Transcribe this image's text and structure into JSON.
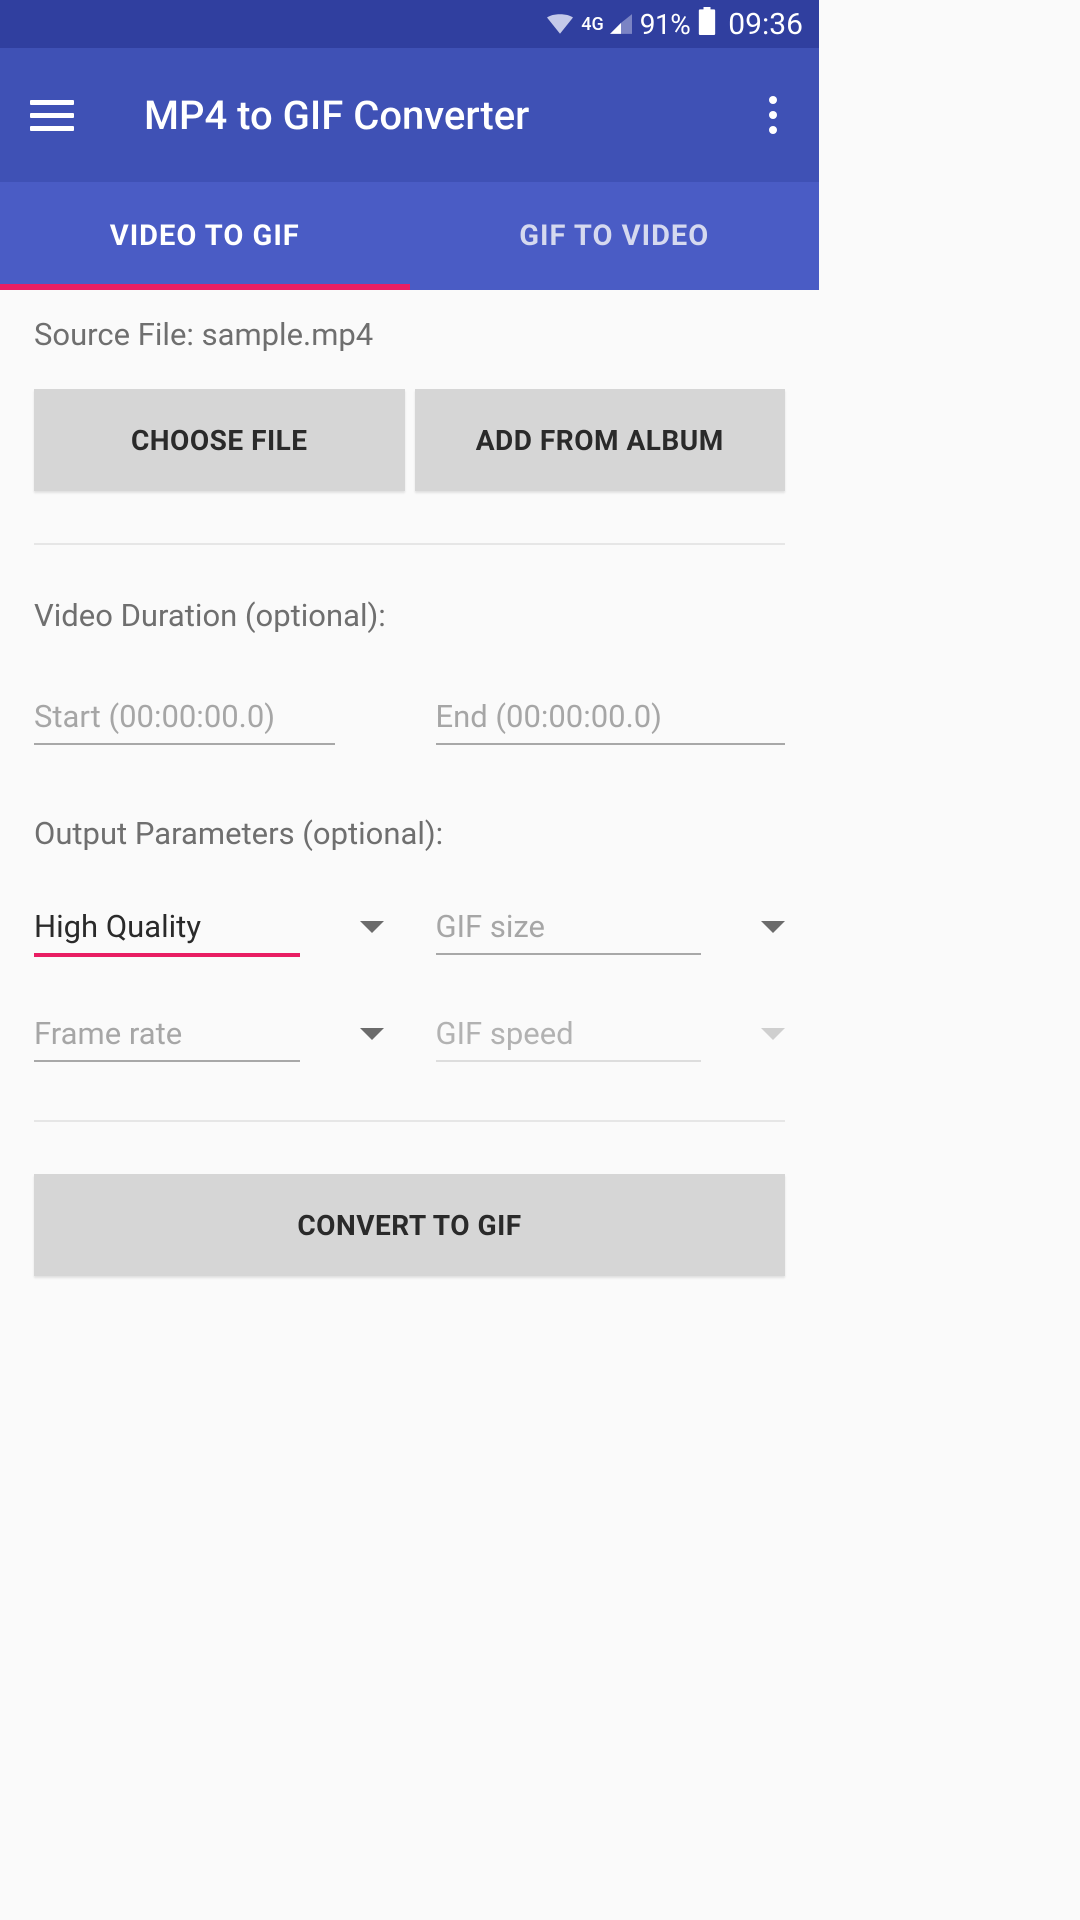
{
  "status": {
    "network": "4G",
    "battery": "91%",
    "time": "09:36"
  },
  "header": {
    "title": "MP4 to GIF Converter"
  },
  "tabs": {
    "tab1": "VIDEO TO GIF",
    "tab2": "GIF TO VIDEO"
  },
  "source": {
    "label": "Source File: ",
    "filename": "sample.mp4"
  },
  "buttons": {
    "choose_file": "CHOOSE FILE",
    "add_from_album": "ADD FROM ALBUM",
    "convert": "CONVERT TO GIF"
  },
  "duration": {
    "label": "Video Duration (optional):",
    "start_placeholder": "Start (00:00:00.0)",
    "end_placeholder": "End (00:00:00.0)"
  },
  "output": {
    "label": "Output Parameters (optional):",
    "quality": "High Quality",
    "size_placeholder": "GIF size",
    "framerate_placeholder": "Frame rate",
    "speed_placeholder": "GIF speed"
  }
}
